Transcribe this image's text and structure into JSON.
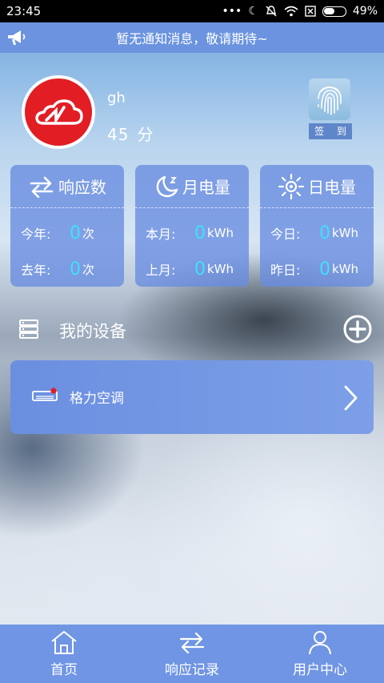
{
  "status_bar": {
    "time": "23:45",
    "battery": "49%",
    "battery_level": 0.49
  },
  "notice": {
    "text": "暂无通知消息，敬请期待~"
  },
  "profile": {
    "username": "gh",
    "score": "45",
    "score_unit": "分",
    "signin_label": "签 到"
  },
  "stats": [
    {
      "title": "响应数",
      "icon": "swap-arrows-icon",
      "rows": [
        {
          "label": "今年:",
          "value": "0",
          "unit": "次"
        },
        {
          "label": "去年:",
          "value": "0",
          "unit": "次"
        }
      ]
    },
    {
      "title": "月电量",
      "icon": "moon-icon",
      "rows": [
        {
          "label": "本月:",
          "value": "0",
          "unit": "kWh"
        },
        {
          "label": "上月:",
          "value": "0",
          "unit": "kWh"
        }
      ]
    },
    {
      "title": "日电量",
      "icon": "sun-icon",
      "rows": [
        {
          "label": "今日:",
          "value": "0",
          "unit": "kWh"
        },
        {
          "label": "昨日:",
          "value": "0",
          "unit": "kWh"
        }
      ]
    }
  ],
  "devices": {
    "title": "我的设备",
    "items": [
      {
        "name": "格力空调",
        "icon": "air-conditioner-icon"
      }
    ]
  },
  "tabbar": {
    "items": [
      {
        "label": "首页",
        "icon": "home-icon"
      },
      {
        "label": "响应记录",
        "icon": "swap-arrows-icon"
      },
      {
        "label": "用户中心",
        "icon": "user-icon"
      }
    ]
  },
  "colors": {
    "accent": "#6b93df",
    "value_highlight": "#3ee0ff",
    "logo_red": "#e21d24"
  }
}
